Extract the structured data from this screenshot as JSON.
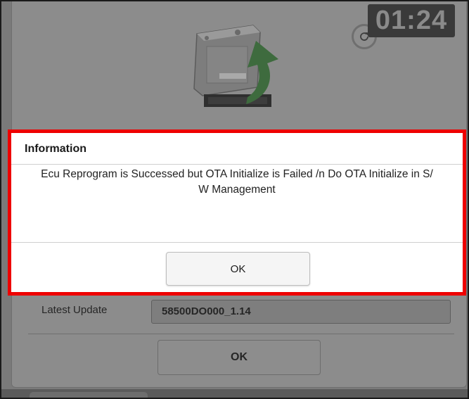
{
  "background": {
    "timer": "01:24",
    "latest_update_label": "Latest Update",
    "latest_update_value": "58500DO000_1.14",
    "ok_label": "OK",
    "illustration_icon": "ecu-upload-icon",
    "refresh_icon": "refresh-icon"
  },
  "dialog": {
    "title": "Information",
    "message_line1": "Ecu Reprogram is Successed but OTA Initialize is Failed /n Do OTA Initialize in S/",
    "message_line2": "W Management",
    "ok_label": "OK",
    "highlight_color": "#ee0000"
  }
}
